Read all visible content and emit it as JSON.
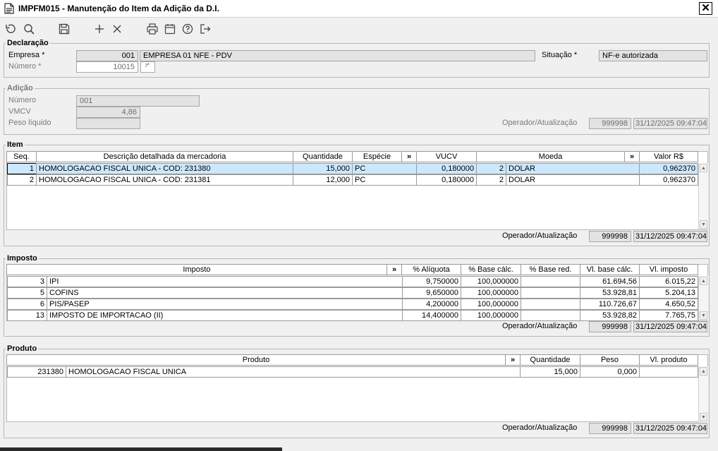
{
  "window": {
    "title": "IMPFM015 - Manutenção do Item da Adição da D.I.",
    "close_label": "✕"
  },
  "toolbar": {
    "icons": [
      "undo-icon",
      "search-icon",
      "save-icon",
      "add-icon",
      "delete-icon",
      "print-icon",
      "calendar-icon",
      "help-icon",
      "exit-icon"
    ]
  },
  "declaracao": {
    "legend": "Declaração",
    "empresa_label": "Empresa *",
    "empresa_code": "001",
    "empresa_name": "EMPRESA 01 NFE - PDV",
    "numero_label": "Número *",
    "numero_value": "10015",
    "situacao_label": "Situação *",
    "situacao_value": "NF-e autorizada"
  },
  "adicao": {
    "legend": "Adição",
    "numero_label": "Número",
    "numero_value": "001",
    "vmcv_label": "VMCV",
    "vmcv_value": "4,86",
    "peso_label": "Peso líquido",
    "peso_value": "",
    "operador_label": "Operador/Atualização",
    "operador_value": "999998",
    "data_value": "31/12/2025 09:47:04"
  },
  "item": {
    "legend": "Item",
    "headers": [
      "Seq.",
      "Descrição detalhada da mercadoria",
      "Quantidade",
      "Espécie",
      "»",
      "VUCV",
      "Moeda",
      "»",
      "Valor R$"
    ],
    "rows": [
      {
        "seq": "1",
        "desc": "HOMOLOGACAO FISCAL UNICA - COD: 231380",
        "qtd": "15,000",
        "esp": "PC",
        "vucv": "0,180000",
        "moeda_cod": "2",
        "moeda": "DOLAR",
        "valor": "0,962370"
      },
      {
        "seq": "2",
        "desc": "HOMOLOGACAO FISCAL UNICA - COD: 231381",
        "qtd": "12,000",
        "esp": "PC",
        "vucv": "0,180000",
        "moeda_cod": "2",
        "moeda": "DOLAR",
        "valor": "0,962370"
      }
    ],
    "operador_label": "Operador/Atualização",
    "operador_value": "999998",
    "data_value": "31/12/2025 09:47:04"
  },
  "imposto": {
    "legend": "Imposto",
    "headers": [
      "Imposto",
      "»",
      "% Alíquota",
      "% Base cálc.",
      "% Base red.",
      "Vl. base cálc.",
      "Vl. imposto"
    ],
    "rows": [
      {
        "cod": "3",
        "nome": "IPI",
        "aliq": "9,750000",
        "base": "100,000000",
        "red": "",
        "vbase": "61.694,56",
        "vimp": "6.015,22"
      },
      {
        "cod": "5",
        "nome": "COFINS",
        "aliq": "9,650000",
        "base": "100,000000",
        "red": "",
        "vbase": "53.928,81",
        "vimp": "5.204,13"
      },
      {
        "cod": "6",
        "nome": "PIS/PASEP",
        "aliq": "4,200000",
        "base": "100,000000",
        "red": "",
        "vbase": "110.726,67",
        "vimp": "4.650,52"
      },
      {
        "cod": "13",
        "nome": "IMPOSTO DE IMPORTACAO (II)",
        "aliq": "14,400000",
        "base": "100,000000",
        "red": "",
        "vbase": "53.928,82",
        "vimp": "7.765,75"
      }
    ],
    "operador_label": "Operador/Atualização",
    "operador_value": "999998",
    "data_value": "31/12/2025 09:47:04"
  },
  "produto": {
    "legend": "Produto",
    "headers": [
      "Produto",
      "»",
      "Quantidade",
      "Peso",
      "Vl. produto"
    ],
    "rows": [
      {
        "cod": "231380",
        "nome": "HOMOLOGACAO FISCAL UNICA",
        "qtd": "15,000",
        "peso": "0,000",
        "vprod": ""
      }
    ],
    "operador_label": "Operador/Atualização",
    "operador_value": "999998",
    "data_value": "31/12/2025 09:47:04"
  }
}
